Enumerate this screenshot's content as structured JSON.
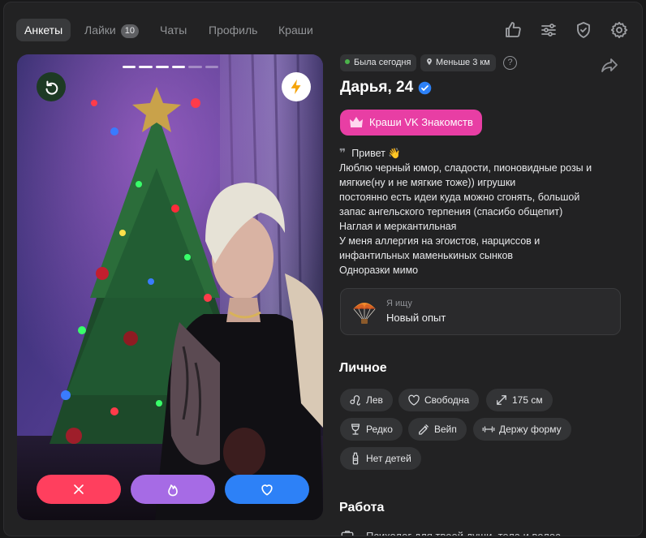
{
  "nav": {
    "tabs": [
      {
        "label": "Анкеты",
        "active": true
      },
      {
        "label": "Лайки",
        "badge": "10"
      },
      {
        "label": "Чаты"
      },
      {
        "label": "Профиль"
      },
      {
        "label": "Краши"
      }
    ],
    "icons": [
      "like-icon",
      "filters-icon",
      "shield-icon",
      "gear-icon"
    ]
  },
  "photo": {
    "slides_total": 6,
    "current_slide": 4,
    "top_left_icon": "undo-icon",
    "top_right_icon": "lightning-icon",
    "actions": [
      "dislike-icon",
      "superlike-fire-icon",
      "like-heart-icon"
    ],
    "colors": {
      "dislike": "#ff3f5e",
      "superlike": "#a66be5",
      "like": "#2d81f7"
    }
  },
  "profile": {
    "status": "Была сегодня",
    "distance": "Меньше 3 км",
    "help": "?",
    "name": "Дарья, 24",
    "crush_button": "Краши VK Знакомств",
    "bio_lines": [
      "Привет 👋",
      "Люблю черный юмор, сладости, пионовидные розы и",
      "мягкие(ну и не мягкие тоже)) игрушки",
      "постоянно есть идеи куда можно сгонять, большой",
      "запас ангельского терпения (спасибо общепит)",
      "Наглая и меркантильная",
      "У меня аллергия на эгоистов, нарциссов и",
      "инфантильных маменькиных сынков",
      "Одноразки мимо"
    ],
    "seeking": {
      "label": "Я ищу",
      "value": "Новый опыт"
    },
    "personal_title": "Личное",
    "tags": [
      {
        "label": "Лев",
        "icon": "leo-icon"
      },
      {
        "label": "Свободна",
        "icon": "heart-icon"
      },
      {
        "label": "175 см",
        "icon": "height-icon"
      },
      {
        "label": "Редко",
        "icon": "glass-icon"
      },
      {
        "label": "Вейп",
        "icon": "vape-icon"
      },
      {
        "label": "Держу форму",
        "icon": "dumbbell-icon"
      },
      {
        "label": "Нет детей",
        "icon": "bottle-icon"
      }
    ],
    "work_title": "Работа",
    "work_text": "Психолог для твоей души, тела и волос"
  }
}
